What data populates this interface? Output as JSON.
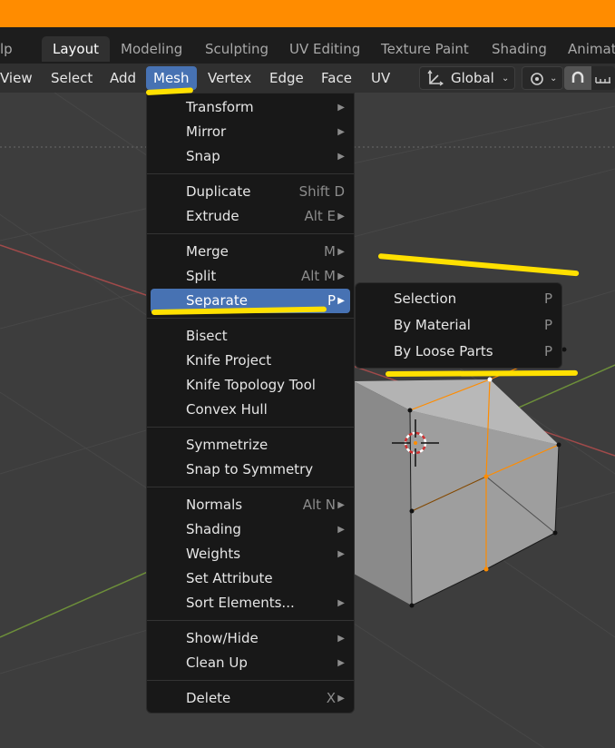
{
  "workspace_tabs": [
    "lp",
    "Layout",
    "Modeling",
    "Sculpting",
    "UV Editing",
    "Texture Paint",
    "Shading",
    "Animat"
  ],
  "active_workspace": "Layout",
  "header_menus": [
    "View",
    "Select",
    "Add",
    "Mesh",
    "Vertex",
    "Edge",
    "Face",
    "UV"
  ],
  "active_header_menu": "Mesh",
  "orientation": {
    "value": "Global",
    "icon": "transform-orientation-icon"
  },
  "pivot_icon": "proportional-editing-icon",
  "snap_icon": "magnet-icon",
  "mesh_menu": {
    "items": [
      {
        "label": "Transform",
        "shortcut": "",
        "submenu": true
      },
      {
        "label": "Mirror",
        "shortcut": "",
        "submenu": true
      },
      {
        "label": "Snap",
        "shortcut": "",
        "submenu": true
      },
      {
        "label": "Duplicate",
        "shortcut": "Shift D",
        "submenu": false
      },
      {
        "label": "Extrude",
        "shortcut": "Alt E",
        "submenu": true
      },
      {
        "label": "Merge",
        "shortcut": "M",
        "submenu": true
      },
      {
        "label": "Split",
        "shortcut": "Alt M",
        "submenu": true
      },
      {
        "label": "Separate",
        "shortcut": "P",
        "submenu": true
      },
      {
        "label": "Bisect",
        "shortcut": "",
        "submenu": false
      },
      {
        "label": "Knife Project",
        "shortcut": "",
        "submenu": false
      },
      {
        "label": "Knife Topology Tool",
        "shortcut": "",
        "submenu": false
      },
      {
        "label": "Convex Hull",
        "shortcut": "",
        "submenu": false
      },
      {
        "label": "Symmetrize",
        "shortcut": "",
        "submenu": false
      },
      {
        "label": "Snap to Symmetry",
        "shortcut": "",
        "submenu": false
      },
      {
        "label": "Normals",
        "shortcut": "Alt N",
        "submenu": true
      },
      {
        "label": "Shading",
        "shortcut": "",
        "submenu": true
      },
      {
        "label": "Weights",
        "shortcut": "",
        "submenu": true
      },
      {
        "label": "Set Attribute",
        "shortcut": "",
        "submenu": false
      },
      {
        "label": "Sort Elements...",
        "shortcut": "",
        "submenu": true
      },
      {
        "label": "Show/Hide",
        "shortcut": "",
        "submenu": true
      },
      {
        "label": "Clean Up",
        "shortcut": "",
        "submenu": true
      },
      {
        "label": "Delete",
        "shortcut": "X",
        "submenu": true
      }
    ],
    "highlighted": "Separate"
  },
  "separate_submenu": {
    "items": [
      {
        "label": "Selection",
        "shortcut": "P"
      },
      {
        "label": "By Material",
        "shortcut": "P"
      },
      {
        "label": "By Loose Parts",
        "shortcut": "P"
      }
    ]
  },
  "colors": {
    "title_bar": "#ff8c00",
    "accent": "#4772b3",
    "menu_bg": "#181818",
    "annotation": "#ffe000",
    "selection_edge": "#ff8c00"
  }
}
